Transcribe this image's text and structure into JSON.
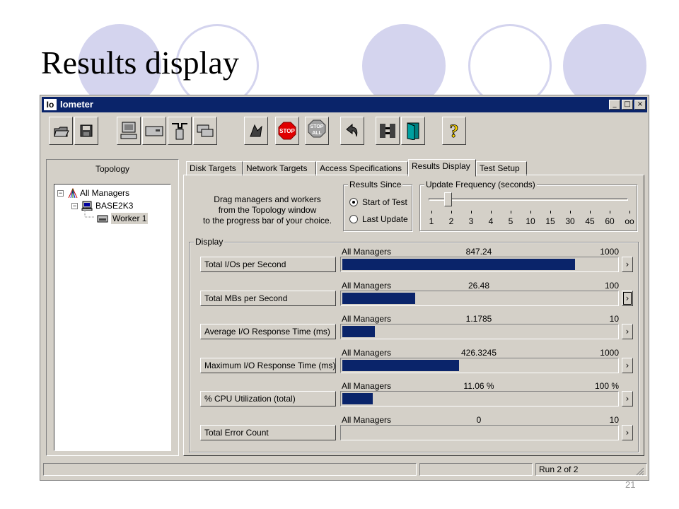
{
  "slide": {
    "title": "Results display",
    "page_number": "21"
  },
  "window": {
    "app_icon_text": "Io",
    "title": "Iometer",
    "controls": {
      "minimize": "_",
      "maximize": "□",
      "close": "×"
    }
  },
  "toolbar": {
    "buttons": [
      {
        "name": "open-icon"
      },
      {
        "name": "save-icon"
      },
      {
        "name": "new-manager-icon"
      },
      {
        "name": "new-disk-worker-icon"
      },
      {
        "name": "new-network-worker-icon"
      },
      {
        "name": "duplicate-worker-icon"
      },
      {
        "name": "start-icon"
      },
      {
        "name": "stop-icon",
        "label": "STOP"
      },
      {
        "name": "stop-all-icon",
        "label": "STOP",
        "sublabel": "ALL"
      },
      {
        "name": "reset-workers-icon"
      },
      {
        "name": "disconnect-icon"
      },
      {
        "name": "exit-icon"
      },
      {
        "name": "help-icon",
        "label": "?"
      }
    ]
  },
  "topology": {
    "header": "Topology",
    "tree": [
      {
        "label": "All Managers",
        "expander": "−"
      },
      {
        "label": "BASE2K3",
        "expander": "−"
      },
      {
        "label": "Worker 1",
        "selected": true
      }
    ]
  },
  "tabs": [
    {
      "label": "Disk Targets",
      "active": false
    },
    {
      "label": "Network Targets",
      "active": false
    },
    {
      "label": "Access Specifications",
      "active": false
    },
    {
      "label": "Results Display",
      "active": true
    },
    {
      "label": "Test Setup",
      "active": false
    }
  ],
  "results_display": {
    "drag_text": [
      "Drag managers and workers",
      "from the Topology window",
      "to the progress bar of your choice."
    ],
    "results_since": {
      "label": "Results Since",
      "options": [
        {
          "label": "Start of Test",
          "selected": true
        },
        {
          "label": "Last Update",
          "selected": false
        }
      ]
    },
    "update_frequency": {
      "label": "Update Frequency (seconds)",
      "ticks": [
        "1",
        "2",
        "3",
        "4",
        "5",
        "10",
        "15",
        "30",
        "45",
        "60",
        "oo"
      ],
      "selected": "2"
    },
    "display_label": "Display",
    "metrics": [
      {
        "button": "Total I/Os per Second",
        "manager": "All Managers",
        "value": "847.24",
        "max": "1000",
        "fraction": 0.847
      },
      {
        "button": "Total MBs per Second",
        "manager": "All Managers",
        "value": "26.48",
        "max": "100",
        "fraction": 0.265,
        "focused": true
      },
      {
        "button": "Average I/O Response Time (ms)",
        "manager": "All Managers",
        "value": "1.1785",
        "max": "10",
        "fraction": 0.118
      },
      {
        "button": "Maximum I/O Response Time (ms)",
        "manager": "All Managers",
        "value": "426.3245",
        "max": "1000",
        "fraction": 0.426
      },
      {
        "button": "% CPU Utilization (total)",
        "manager": "All Managers",
        "value": "11.06 %",
        "max": "100 %",
        "fraction": 0.111
      },
      {
        "button": "Total Error Count",
        "manager": "All Managers",
        "value": "0",
        "max": "10",
        "fraction": 0
      }
    ],
    "arrow_label": "›"
  },
  "statusbar": {
    "run_status": "Run 2 of 2"
  },
  "colors": {
    "title_bar": "#0a246a",
    "bar_fill": "#0a246a",
    "window_bg": "#d4d0c8",
    "slide_circle": "#d4d4ee"
  }
}
